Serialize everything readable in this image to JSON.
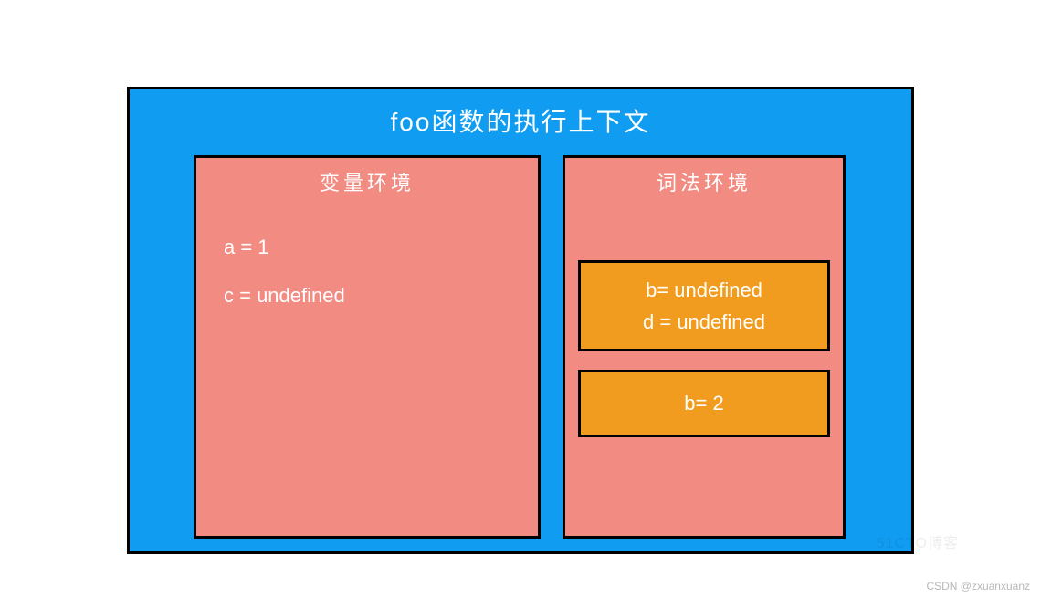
{
  "context": {
    "title": "foo函数的执行上下文",
    "variable_env": {
      "title": "变量环境",
      "lines": [
        "a = 1",
        "c = undefined"
      ]
    },
    "lexical_env": {
      "title": "词法环境",
      "blocks": [
        {
          "lines": [
            "b= undefined",
            "d = undefined"
          ]
        },
        {
          "lines": [
            "b= 2"
          ]
        }
      ]
    }
  },
  "watermark_faint": "51CTO博客",
  "watermark_credit": "CSDN @zxuanxuanz"
}
